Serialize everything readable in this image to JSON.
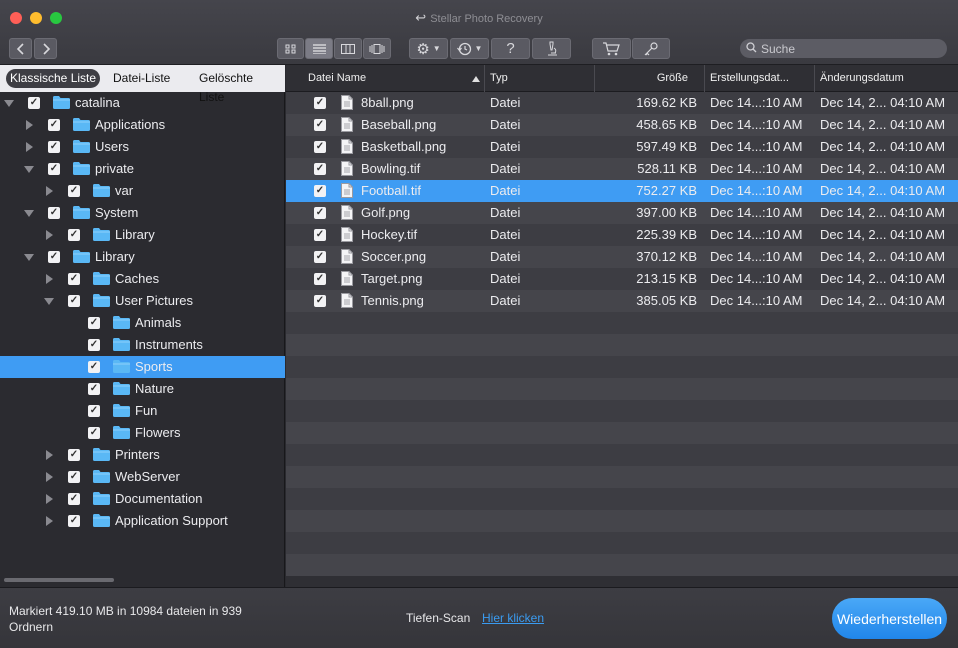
{
  "window": {
    "title": "Stellar Photo Recovery"
  },
  "toolbar": {
    "search_placeholder": "Suche",
    "icons": [
      "back-arrow-icon",
      "forward-arrow-icon",
      "icon-view-icon",
      "list-view-icon",
      "column-view-icon",
      "coverflow-view-icon",
      "gear-icon",
      "history-icon",
      "help-icon",
      "microscope-icon",
      "cart-icon",
      "key-icon",
      "search-icon"
    ],
    "help_label": "?"
  },
  "left_tabs": [
    "Klassische Liste",
    "Datei-Liste",
    "Gelöschte Liste"
  ],
  "tree": [
    {
      "label": "catalina",
      "level": 0,
      "arrow": "down"
    },
    {
      "label": "Applications",
      "level": 1,
      "arrow": "right"
    },
    {
      "label": "Users",
      "level": 1,
      "arrow": "right"
    },
    {
      "label": "private",
      "level": 1,
      "arrow": "down"
    },
    {
      "label": "var",
      "level": 2,
      "arrow": "right"
    },
    {
      "label": "System",
      "level": 1,
      "arrow": "down"
    },
    {
      "label": "Library",
      "level": 2,
      "arrow": "right"
    },
    {
      "label": "Library",
      "level": 1,
      "arrow": "down"
    },
    {
      "label": "Caches",
      "level": 2,
      "arrow": "right"
    },
    {
      "label": "User Pictures",
      "level": 2,
      "arrow": "down"
    },
    {
      "label": "Animals",
      "level": 3,
      "arrow": "none"
    },
    {
      "label": "Instruments",
      "level": 3,
      "arrow": "none"
    },
    {
      "label": "Sports",
      "level": 3,
      "arrow": "none",
      "selected": true
    },
    {
      "label": "Nature",
      "level": 3,
      "arrow": "none"
    },
    {
      "label": "Fun",
      "level": 3,
      "arrow": "none"
    },
    {
      "label": "Flowers",
      "level": 3,
      "arrow": "none"
    },
    {
      "label": "Printers",
      "level": 2,
      "arrow": "right"
    },
    {
      "label": "WebServer",
      "level": 2,
      "arrow": "right"
    },
    {
      "label": "Documentation",
      "level": 2,
      "arrow": "right"
    },
    {
      "label": "Application Support",
      "level": 2,
      "arrow": "right"
    }
  ],
  "columns": [
    "Datei Name",
    "Typ",
    "Größe",
    "Erstellungsdat...",
    "Änderungsdatum"
  ],
  "files": [
    {
      "name": "8ball.png",
      "type": "Datei",
      "size": "169.62 KB",
      "created": "Dec 14...:10 AM",
      "modified": "Dec 14, 2... 04:10 AM"
    },
    {
      "name": "Baseball.png",
      "type": "Datei",
      "size": "458.65 KB",
      "created": "Dec 14...:10 AM",
      "modified": "Dec 14, 2... 04:10 AM"
    },
    {
      "name": "Basketball.png",
      "type": "Datei",
      "size": "597.49 KB",
      "created": "Dec 14...:10 AM",
      "modified": "Dec 14, 2... 04:10 AM"
    },
    {
      "name": "Bowling.tif",
      "type": "Datei",
      "size": "528.11 KB",
      "created": "Dec 14...:10 AM",
      "modified": "Dec 14, 2... 04:10 AM"
    },
    {
      "name": "Football.tif",
      "type": "Datei",
      "size": "752.27 KB",
      "created": "Dec 14...:10 AM",
      "modified": "Dec 14, 2... 04:10 AM",
      "selected": true
    },
    {
      "name": "Golf.png",
      "type": "Datei",
      "size": "397.00 KB",
      "created": "Dec 14...:10 AM",
      "modified": "Dec 14, 2... 04:10 AM"
    },
    {
      "name": "Hockey.tif",
      "type": "Datei",
      "size": "225.39 KB",
      "created": "Dec 14...:10 AM",
      "modified": "Dec 14, 2... 04:10 AM"
    },
    {
      "name": "Soccer.png",
      "type": "Datei",
      "size": "370.12 KB",
      "created": "Dec 14...:10 AM",
      "modified": "Dec 14, 2... 04:10 AM"
    },
    {
      "name": "Target.png",
      "type": "Datei",
      "size": "213.15 KB",
      "created": "Dec 14...:10 AM",
      "modified": "Dec 14, 2... 04:10 AM"
    },
    {
      "name": "Tennis.png",
      "type": "Datei",
      "size": "385.05 KB",
      "created": "Dec 14...:10 AM",
      "modified": "Dec 14, 2... 04:10 AM"
    }
  ],
  "status": {
    "summary": "Markiert 419.10 MB in 10984 dateien in 939 Ordnern",
    "deep_scan_label": "Tiefen-Scan",
    "deep_scan_link": "Hier klicken",
    "restore_button": "Wiederherstellen"
  },
  "colors": {
    "accent": "#3f9cf3",
    "folder": "#5ab8f5",
    "restore": "#2186ea"
  }
}
